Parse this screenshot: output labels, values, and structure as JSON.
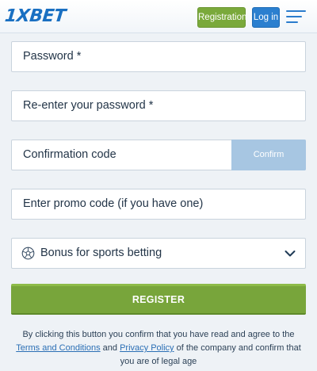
{
  "header": {
    "logo": "1XBET",
    "registration_label": "Registration",
    "login_label": "Log in",
    "menu_icon": "hamburger-menu-icon"
  },
  "form": {
    "password_placeholder": "Password  *",
    "reenter_password_placeholder": "Re-enter your password  *",
    "confirmation_code_placeholder": "Confirmation code",
    "confirm_label": "Confirm",
    "promo_placeholder": "Enter promo code (if you have one)",
    "bonus_selected": "Bonus for sports betting",
    "bonus_icon": "soccer-ball-icon",
    "register_label": "REGISTER"
  },
  "terms": {
    "part1": "By clicking this button you confirm that you have read and agree to the ",
    "terms_link": "Terms and Conditions",
    "part2": " and ",
    "privacy_link": "Privacy Policy",
    "part3": " of the company and confirm that you are of legal age"
  },
  "colors": {
    "brand_blue": "#1a70c2",
    "registration_green": "#7aa93b",
    "login_blue": "#2b7fcf",
    "confirm_disabled": "#a7c6e2",
    "register_green": "#78a53b"
  }
}
